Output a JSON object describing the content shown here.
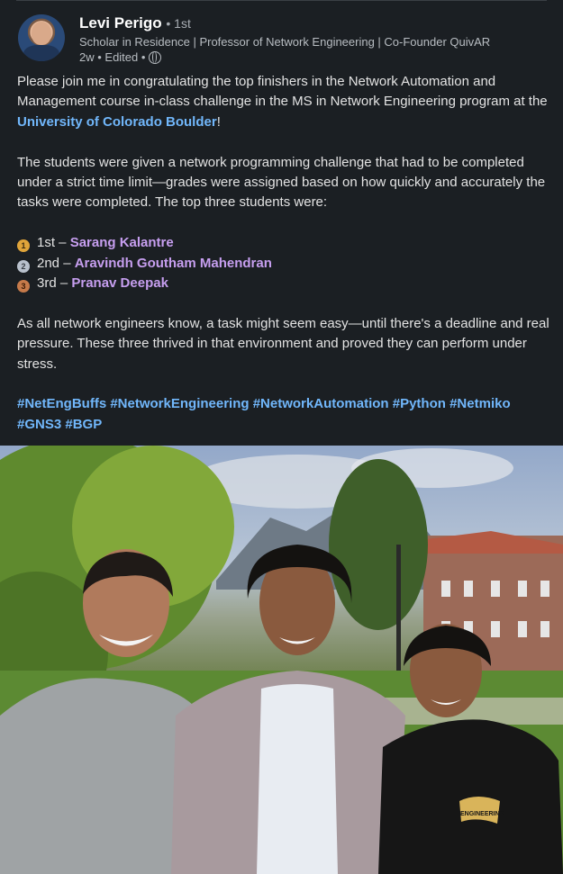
{
  "author": {
    "name": "Levi Perigo",
    "degree": "• 1st",
    "headline": "Scholar in Residence | Professor of Network Engineering | Co-Founder QuivAR",
    "meta": "2w • Edited •"
  },
  "post": {
    "p1_a": "Please join me in congratulating the top finishers in the Network Automation and Management course in-class challenge in the MS in Network Engineering program at the ",
    "p1_link": "University of Colorado Boulder",
    "p1_b": "!",
    "p2": "The students were given a network programming challenge that had to be completed under a strict time limit—grades were assigned based on how quickly and accurately the tasks were completed. The top three students were:",
    "winners": [
      {
        "place": "1st – ",
        "name": "Sarang Kalantre",
        "medal": "gold",
        "medal_num": "1"
      },
      {
        "place": "2nd – ",
        "name": "Aravindh Goutham Mahendran",
        "medal": "silver",
        "medal_num": "2"
      },
      {
        "place": "3rd – ",
        "name": "Pranav Deepak",
        "medal": "bronze",
        "medal_num": "3"
      }
    ],
    "p3": "As all network engineers know, a task might seem easy—until there's a deadline and real pressure. These three thrived in that environment and proved they can perform under stress.",
    "hashtags": [
      "#NetEngBuffs",
      "#NetworkEngineering",
      "#NetworkAutomation",
      "#Python",
      "#Netmiko",
      "#GNS3",
      "#BGP"
    ]
  },
  "photo": {
    "shirt_text": "ENGINEERING"
  }
}
